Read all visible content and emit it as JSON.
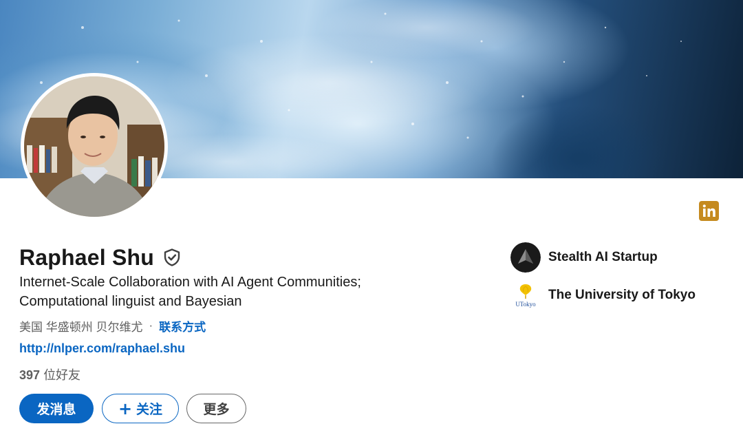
{
  "profile": {
    "name": "Raphael Shu",
    "headline_line1": "Internet-Scale Collaboration with AI Agent Communities;",
    "headline_line2": "Computational linguist and Bayesian",
    "location": "美国 华盛顿州 贝尔维尤",
    "separator": "·",
    "contact_info_label": "联系方式",
    "website": "http://nlper.com/raphael.shu",
    "connections_count": "397",
    "connections_label": "位好友"
  },
  "actions": {
    "message_label": "发消息",
    "follow_plus": "+",
    "follow_label": "关注",
    "more_label": "更多"
  },
  "organizations": [
    {
      "name": "Stealth AI Startup",
      "logo_icon": "stealth-logo-icon"
    },
    {
      "name": "The University of Tokyo",
      "logo_icon": "utokyo-logo-icon",
      "logo_text": "UTokyo"
    }
  ],
  "colors": {
    "primary_blue": "#0a66c2",
    "linkedin_icon_bg": "#c58a1f",
    "text_primary": "#191919",
    "text_secondary": "#5e5e5e"
  }
}
